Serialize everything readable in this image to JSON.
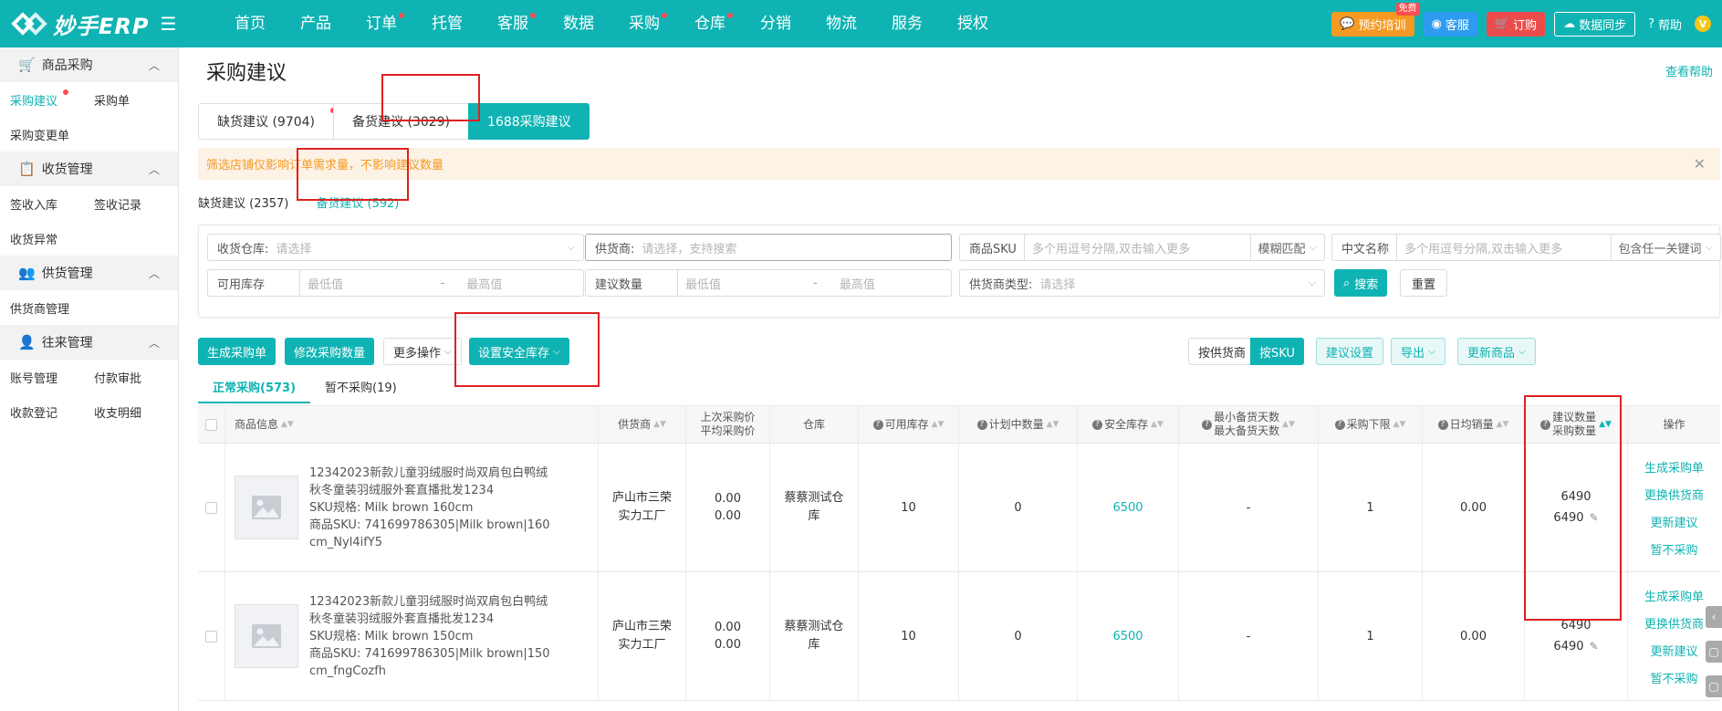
{
  "app": {
    "logo_text": "妙手ERP"
  },
  "topnav": {
    "items": [
      {
        "label": "首页",
        "dot": false
      },
      {
        "label": "产品",
        "dot": false
      },
      {
        "label": "订单",
        "dot": true
      },
      {
        "label": "托管",
        "dot": false
      },
      {
        "label": "客服",
        "dot": true
      },
      {
        "label": "数据",
        "dot": false
      },
      {
        "label": "采购",
        "dot": true
      },
      {
        "label": "仓库",
        "dot": true
      },
      {
        "label": "分销",
        "dot": false
      },
      {
        "label": "物流",
        "dot": false
      },
      {
        "label": "服务",
        "dot": false
      },
      {
        "label": "授权",
        "dot": false
      }
    ],
    "training": "预约培训",
    "free_badge": "免费",
    "service": "客服",
    "subscribe": "订购",
    "sync": "数据同步",
    "help": "帮助",
    "avatar_letter": "V"
  },
  "sidebar": {
    "groups": [
      {
        "title": "商品采购",
        "icon": "🛒",
        "rows": [
          [
            "采购建议",
            "采购单"
          ],
          [
            "采购变更单"
          ]
        ]
      },
      {
        "title": "收货管理",
        "icon": "📋",
        "rows": [
          [
            "签收入库",
            "签收记录"
          ],
          [
            "收货异常"
          ]
        ]
      },
      {
        "title": "供货管理",
        "icon": "👥",
        "rows": [
          [
            "供货商管理"
          ]
        ]
      },
      {
        "title": "往来管理",
        "icon": "👤",
        "rows": [
          [
            "账号管理",
            "付款审批"
          ],
          [
            "收款登记",
            "收支明细"
          ]
        ]
      }
    ]
  },
  "page": {
    "title": "采购建议",
    "help": "查看帮助",
    "tabs": [
      "缺货建议 (9704)",
      "备货建议 (3029)",
      "1688采购建议"
    ],
    "notice": "筛选店铺仅影响订单需求量，不影响建议数量",
    "subtabs": [
      "缺货建议 (2357)",
      "备货建议 (592)"
    ]
  },
  "filters": {
    "warehouse_label": "收货仓库:",
    "warehouse_ph": "请选择",
    "supplier_label": "供货商:",
    "supplier_ph": "请选择，支持搜索",
    "sku_label": "商品SKU",
    "sku_ph": "多个用逗号分隔,双击输入更多",
    "fuzzy": "模糊匹配",
    "cn_name_label": "中文名称",
    "cn_name_ph": "多个用逗号分隔,双击输入更多",
    "keyword_mode": "包含任一关键词",
    "stock_label": "可用库存",
    "min_ph": "最低值",
    "dash": "-",
    "max_ph": "最高值",
    "qty_label": "建议数量",
    "supplier_type_label": "供货商类型:",
    "supplier_type_ph": "请选择",
    "search": "搜索",
    "reset": "重置"
  },
  "toolbar": {
    "create_po": "生成采购单",
    "modify_qty": "修改采购数量",
    "more_ops": "更多操作",
    "safety_stock": "设置安全库存",
    "by_supplier": "按供货商",
    "by_sku": "按SKU",
    "suggest_settings": "建议设置",
    "export": "导出",
    "update_goods": "更新商品"
  },
  "list_tabs": [
    "正常采购(573)",
    "暂不采购(19)"
  ],
  "table": {
    "headers": {
      "product": "商品信息",
      "supplier": "供货商",
      "last_price": "上次采购价",
      "avg_price": "平均采购价",
      "warehouse": "仓库",
      "avail_stock": "可用库存",
      "planned": "计划中数量",
      "safety": "安全库存",
      "min_days": "最小备货天数",
      "max_days": "最大备货天数",
      "lower_limit": "采购下限",
      "daily_sales": "日均销量",
      "sugg_qty": "建议数量",
      "buy_qty": "采购数量",
      "ops": "操作"
    },
    "rows": [
      {
        "name": "12342023新款儿童羽绒服时尚双肩包白鸭绒秋冬童装羽绒服外套直播批发1234",
        "spec_label": "SKU规格:",
        "spec": "Milk brown 160cm",
        "sku_label": "商品SKU:",
        "sku": "741699786305|Milk brown|160cm_Nyl4ifY5",
        "supplier": "庐山市三荣实力工厂",
        "last_price": "0.00",
        "avg_price": "0.00",
        "warehouse": "蔡蔡测试仓库",
        "avail_stock": "10",
        "planned": "0",
        "safety": "6500",
        "days": "-",
        "lower_limit": "1",
        "daily_sales": "0.00",
        "sugg_qty": "6490",
        "buy_qty": "6490",
        "ops": [
          "生成采购单",
          "更换供货商",
          "更新建议",
          "暂不采购"
        ]
      },
      {
        "name": "12342023新款儿童羽绒服时尚双肩包白鸭绒秋冬童装羽绒服外套直播批发1234",
        "spec_label": "SKU规格:",
        "spec": "Milk brown 150cm",
        "sku_label": "商品SKU:",
        "sku": "741699786305|Milk brown|150cm_fngCozfh",
        "supplier": "庐山市三荣实力工厂",
        "last_price": "0.00",
        "avg_price": "0.00",
        "warehouse": "蔡蔡测试仓库",
        "avail_stock": "10",
        "planned": "0",
        "safety": "6500",
        "days": "-",
        "lower_limit": "1",
        "daily_sales": "0.00",
        "sugg_qty": "6490",
        "buy_qty": "6490",
        "ops": [
          "生成采购单",
          "更换供货商",
          "更新建议",
          "暂不采购"
        ]
      }
    ]
  },
  "colors": {
    "primary": "#0fb3b3",
    "annotation": "#e02020",
    "notice_bg": "#fdf2e6",
    "notice_text": "#f59a23"
  }
}
